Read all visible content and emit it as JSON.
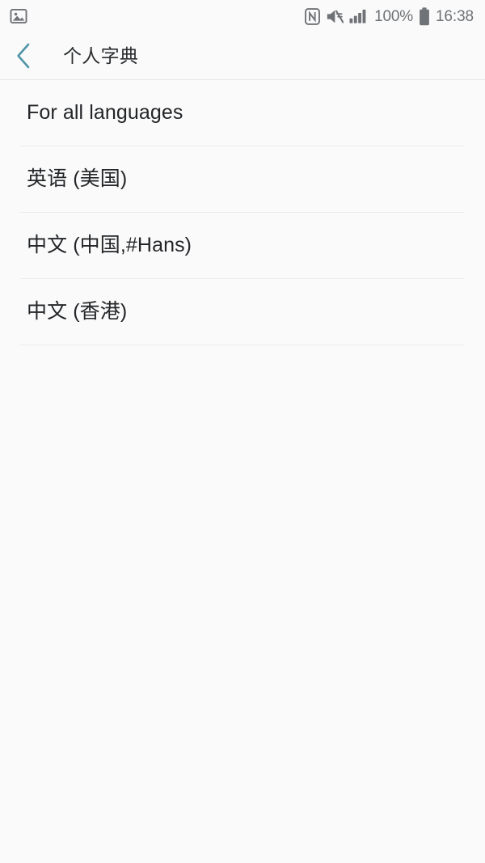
{
  "status_bar": {
    "left_icons": [
      {
        "name": "screenshot-image-icon",
        "glyph": "image"
      }
    ],
    "right_icons": [
      {
        "name": "nfc-icon",
        "glyph": "nfc"
      },
      {
        "name": "sound-mute-icon",
        "glyph": "mute"
      },
      {
        "name": "signal-strength-icon",
        "glyph": "signal",
        "bars": 4
      },
      {
        "name": "battery-icon",
        "glyph": "battery",
        "level": 100
      }
    ],
    "battery_percent": "100%",
    "clock": "16:38"
  },
  "app_bar": {
    "back_icon": "chevron-left-icon",
    "title": "个人字典",
    "accent_color": "#4f94a8",
    "title_color": "#2b2d2f"
  },
  "list": {
    "items": [
      {
        "label": "For all languages"
      },
      {
        "label": "英语 (美国)"
      },
      {
        "label": "中文 (中国,#Hans)"
      },
      {
        "label": "中文 (香港)"
      }
    ]
  },
  "colors": {
    "background": "#fafafa",
    "divider": "#e9eaeb",
    "header_divider": "#e6e7e8",
    "status_icon": "#6f7276",
    "accent": "#4f94a8"
  }
}
